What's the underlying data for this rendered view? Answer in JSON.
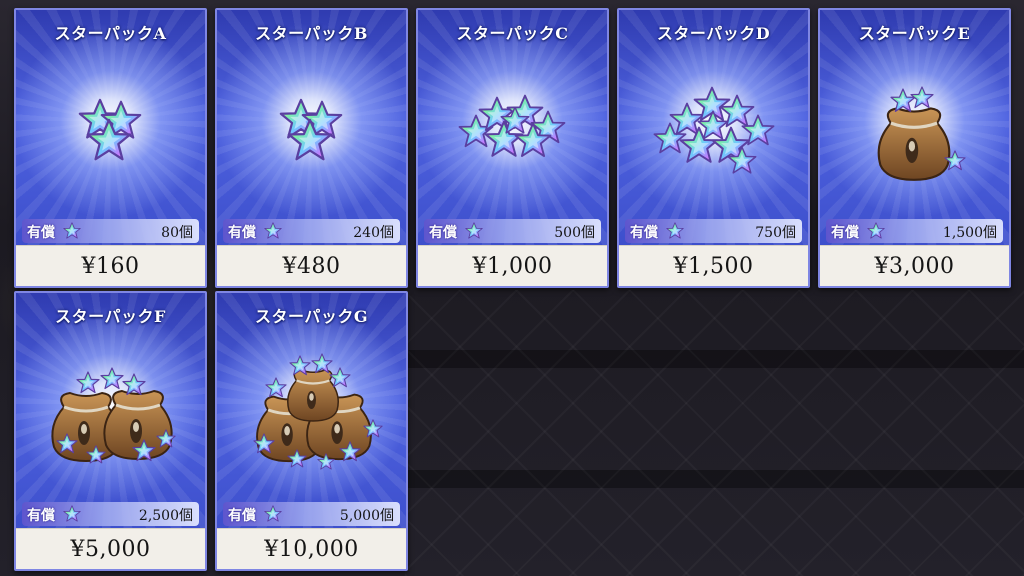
{
  "shop": {
    "packs": [
      {
        "title": "スターパックA",
        "paid_label": "有償",
        "count": "80個",
        "price": "¥160",
        "icon": "star-cluster-small"
      },
      {
        "title": "スターパックB",
        "paid_label": "有償",
        "count": "240個",
        "price": "¥480",
        "icon": "star-cluster-small"
      },
      {
        "title": "スターパックC",
        "paid_label": "有償",
        "count": "500個",
        "price": "¥1,000",
        "icon": "star-pile"
      },
      {
        "title": "スターパックD",
        "paid_label": "有償",
        "count": "750個",
        "price": "¥1,500",
        "icon": "star-pile-large"
      },
      {
        "title": "スターパックE",
        "paid_label": "有償",
        "count": "1,500個",
        "price": "¥3,000",
        "icon": "star-bag"
      },
      {
        "title": "スターパックF",
        "paid_label": "有償",
        "count": "2,500個",
        "price": "¥5,000",
        "icon": "star-bags"
      },
      {
        "title": "スターパックG",
        "paid_label": "有償",
        "count": "5,000個",
        "price": "¥10,000",
        "icon": "star-bags-overflow"
      }
    ]
  },
  "colors": {
    "card_border": "#7f86e3",
    "card_blue": "#3d4fcc",
    "price_bg": "#f2efe9",
    "paid_bar": "#5f55cd"
  }
}
